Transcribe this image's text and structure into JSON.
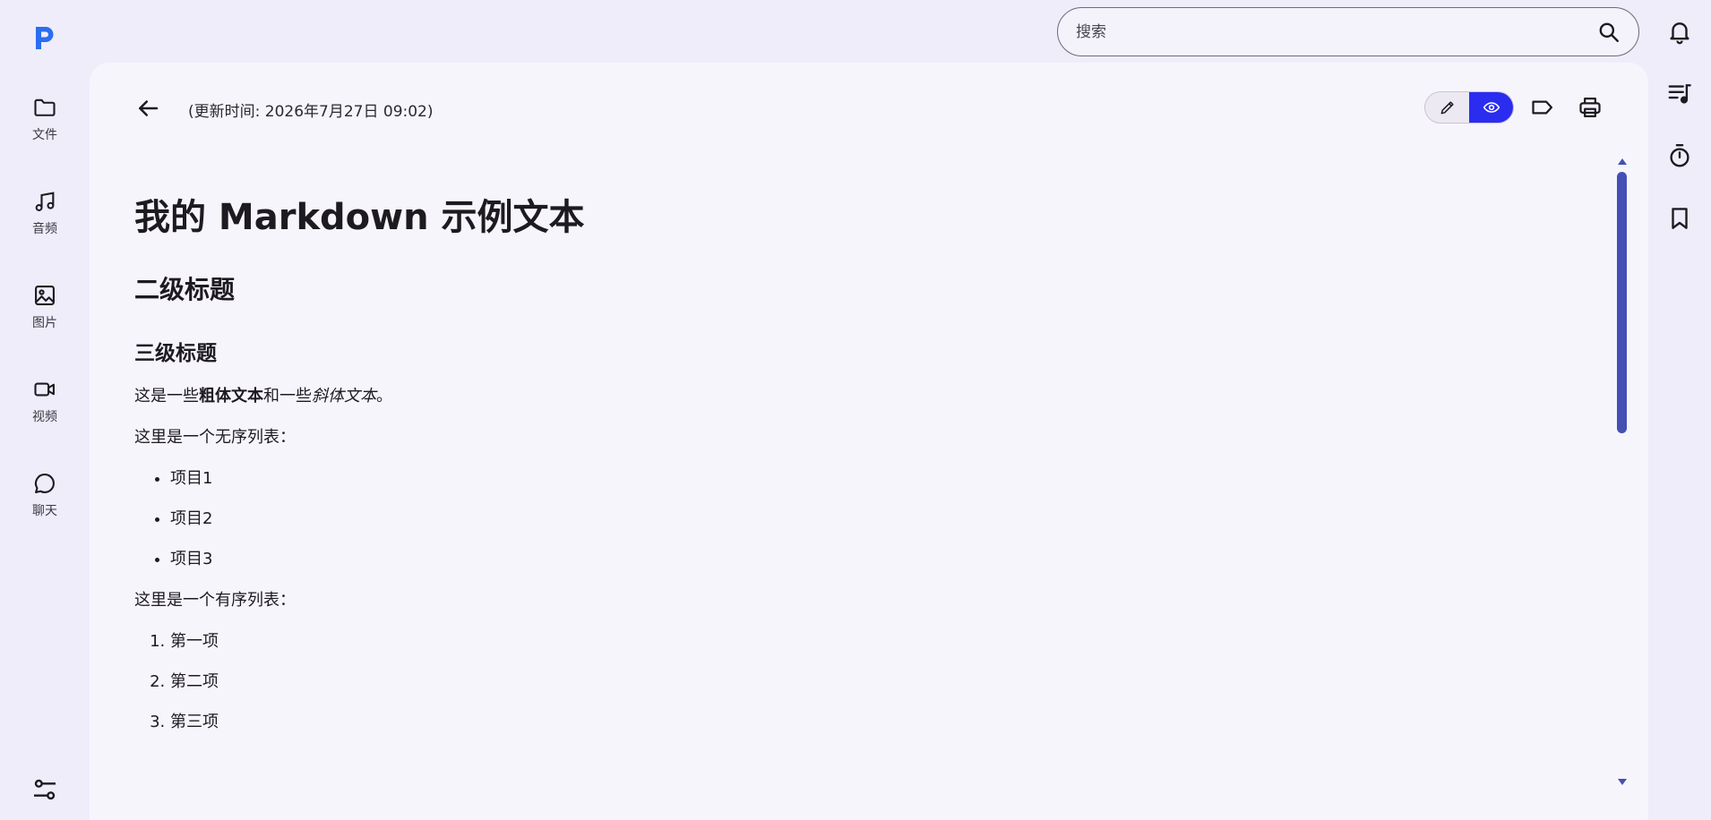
{
  "search": {
    "placeholder": "搜索"
  },
  "left_nav": [
    {
      "label": "文件",
      "icon": "folder-icon"
    },
    {
      "label": "音频",
      "icon": "music-note-icon"
    },
    {
      "label": "图片",
      "icon": "image-icon"
    },
    {
      "label": "视频",
      "icon": "video-icon"
    },
    {
      "label": "聊天",
      "icon": "chat-bubble-icon"
    }
  ],
  "right_rail": [
    "bell-icon",
    "playlist-icon",
    "timer-icon",
    "bookmark-icon"
  ],
  "header": {
    "updated": "(更新时间: 2026年7月27日 09:02)"
  },
  "colors": {
    "accent": "#2a2cf0",
    "scrollbar": "#4450b4",
    "background": "#efedfa",
    "panel": "#f7f5fc"
  },
  "document": {
    "h1": "我的 Markdown 示例文本",
    "h2": "二级标题",
    "h3": "三级标题",
    "para1": {
      "before": "这是一些",
      "bold": "粗体文本",
      "middle": "和一些",
      "italic": "斜体文本",
      "after": "。"
    },
    "unordered_intro": "这里是一个无序列表：",
    "unordered": [
      "项目1",
      "项目2",
      "项目3"
    ],
    "ordered_intro": "这里是一个有序列表：",
    "ordered": [
      "第一项",
      "第二项",
      "第三项"
    ]
  }
}
